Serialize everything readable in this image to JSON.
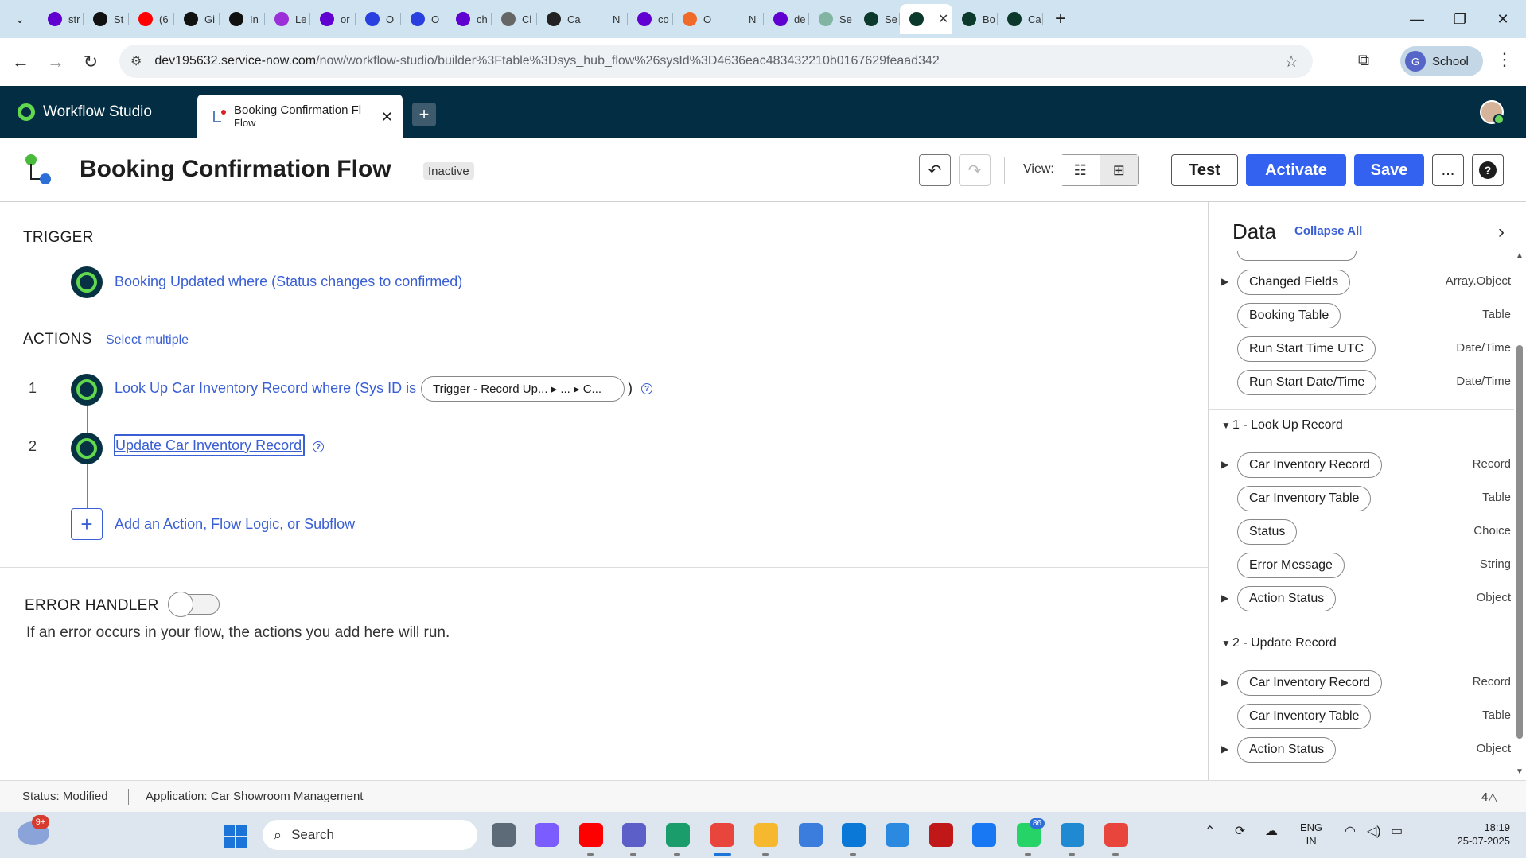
{
  "browser": {
    "tabs": [
      {
        "label": "str",
        "icon": "yahoo-icon",
        "color": "#6001d2"
      },
      {
        "label": "St",
        "icon": "app-tab-icon",
        "color": "#111111"
      },
      {
        "label": "(6",
        "icon": "youtube-icon",
        "color": "#ff0000"
      },
      {
        "label": "Gi",
        "icon": "app-tab-icon",
        "color": "#111111"
      },
      {
        "label": "In",
        "icon": "app-tab-icon",
        "color": "#111111"
      },
      {
        "label": "Le",
        "icon": "learn-icon",
        "color": "#9b30d9"
      },
      {
        "label": "or",
        "icon": "yahoo-icon",
        "color": "#6001d2"
      },
      {
        "label": "O",
        "icon": "pixel-icon",
        "color": "#2a3fe0"
      },
      {
        "label": "O",
        "icon": "pixel-icon",
        "color": "#2a3fe0"
      },
      {
        "label": "ch",
        "icon": "yahoo-icon",
        "color": "#6001d2"
      },
      {
        "label": "Cl",
        "icon": "gear-tab-icon",
        "color": "#666666"
      },
      {
        "label": "Ca",
        "icon": "chatgpt-icon",
        "color": "#222222"
      },
      {
        "label": "N",
        "icon": "blank-tab-icon",
        "color": "#cfe3f0"
      },
      {
        "label": "co",
        "icon": "yahoo-icon",
        "color": "#6001d2"
      },
      {
        "label": "O",
        "icon": "orange-tab-icon",
        "color": "#f06a2a"
      },
      {
        "label": "N",
        "icon": "blank-tab-icon",
        "color": "#cfe3f0"
      },
      {
        "label": "de",
        "icon": "yahoo-icon",
        "color": "#6001d2"
      },
      {
        "label": "Se",
        "icon": "servicenow-icon",
        "color": "#81b5a1"
      },
      {
        "label": "Se",
        "icon": "servicenow-icon",
        "color": "#0b3a2c"
      },
      {
        "label": "",
        "icon": "servicenow-icon",
        "color": "#0b3a2c",
        "active": true
      },
      {
        "label": "Bo",
        "icon": "servicenow-icon",
        "color": "#0b3a2c"
      },
      {
        "label": "Ca",
        "icon": "servicenow-icon",
        "color": "#0b3a2c"
      }
    ],
    "url_host": "dev195632.service-now.com",
    "url_path": "/now/workflow-studio/builder%3Ftable%3Dsys_hub_flow%26sysId%3D4636eac483432210b0167629feaad342",
    "profile_initial": "G",
    "profile_label": "School"
  },
  "app": {
    "name": "Workflow Studio",
    "tab_title": "Booking Confirmation Fl",
    "tab_subtitle": "Flow"
  },
  "flow": {
    "title": "Booking Confirmation Flow",
    "status_badge": "Inactive",
    "view_label": "View:",
    "test_label": "Test",
    "activate_label": "Activate",
    "save_label": "Save",
    "more_label": "...",
    "help_label": "?"
  },
  "canvas": {
    "trigger_heading": "TRIGGER",
    "trigger_text": "Booking Updated where (Status changes to confirmed)",
    "actions_heading": "ACTIONS",
    "select_multiple": "Select multiple",
    "steps": [
      {
        "num": "1",
        "text": "Look Up Car Inventory Record where (Sys ID is",
        "pill": "Trigger - Record Up... ▸ ... ▸ C...",
        "close": ")"
      },
      {
        "num": "2",
        "text": "Update Car Inventory Record"
      }
    ],
    "add_text": "Add an Action, Flow Logic, or Subflow",
    "error_heading": "ERROR HANDLER",
    "error_text": "If an error occurs in your flow, the actions you add here will run.",
    "error_handler_enabled": false
  },
  "data_panel": {
    "title": "Data",
    "collapse_all": "Collapse All",
    "rows_top": [
      {
        "label": "Changed Fields",
        "type": "Array.Object",
        "expandable": true
      },
      {
        "label": "Booking Table",
        "type": "Table",
        "expandable": false
      },
      {
        "label": "Run Start Time UTC",
        "type": "Date/Time",
        "expandable": false
      },
      {
        "label": "Run Start Date/Time",
        "type": "Date/Time",
        "expandable": false
      }
    ],
    "group1": "1 - Look Up Record",
    "rows_g1": [
      {
        "label": "Car Inventory Record",
        "type": "Record",
        "expandable": true
      },
      {
        "label": "Car Inventory Table",
        "type": "Table",
        "expandable": false
      },
      {
        "label": "Status",
        "type": "Choice",
        "expandable": false
      },
      {
        "label": "Error Message",
        "type": "String",
        "expandable": false
      },
      {
        "label": "Action Status",
        "type": "Object",
        "expandable": true
      }
    ],
    "group2": "2 - Update Record",
    "rows_g2": [
      {
        "label": "Car Inventory Record",
        "type": "Record",
        "expandable": true
      },
      {
        "label": "Car Inventory Table",
        "type": "Table",
        "expandable": false
      },
      {
        "label": "Action Status",
        "type": "Object",
        "expandable": true
      }
    ]
  },
  "status": {
    "status_text": "Status: Modified",
    "application_text": "Application: Car Showroom Management",
    "count_text": "4△"
  },
  "taskbar": {
    "weather_badge": "9+",
    "search_label": "Search",
    "whatsapp_badge": "86",
    "lang_line1": "ENG",
    "lang_line2": "IN",
    "time": "18:19",
    "date": "25-07-2025",
    "apps": [
      {
        "name": "task-view-icon",
        "color": "#5d6b78"
      },
      {
        "name": "copilot-icon",
        "color": "#7a5cff"
      },
      {
        "name": "youtube-app-icon",
        "color": "#ff0000"
      },
      {
        "name": "teams-icon",
        "color": "#5b5fc7"
      },
      {
        "name": "edge-icon",
        "color": "#1a9c6b"
      },
      {
        "name": "chrome-icon",
        "color": "#e8453c"
      },
      {
        "name": "file-explorer-icon",
        "color": "#f5b82e"
      },
      {
        "name": "store-icon",
        "color": "#3b7ddd"
      },
      {
        "name": "myhp-icon",
        "color": "#0a78d6"
      },
      {
        "name": "get-help-icon",
        "color": "#2b8ae0"
      },
      {
        "name": "mcafee-icon",
        "color": "#c01818"
      },
      {
        "name": "facebook-icon",
        "color": "#1877f2"
      },
      {
        "name": "whatsapp-icon",
        "color": "#25d366"
      },
      {
        "name": "vscode-icon",
        "color": "#1f8ad2"
      },
      {
        "name": "chrome-profile-icon",
        "color": "#e8453c"
      }
    ]
  }
}
